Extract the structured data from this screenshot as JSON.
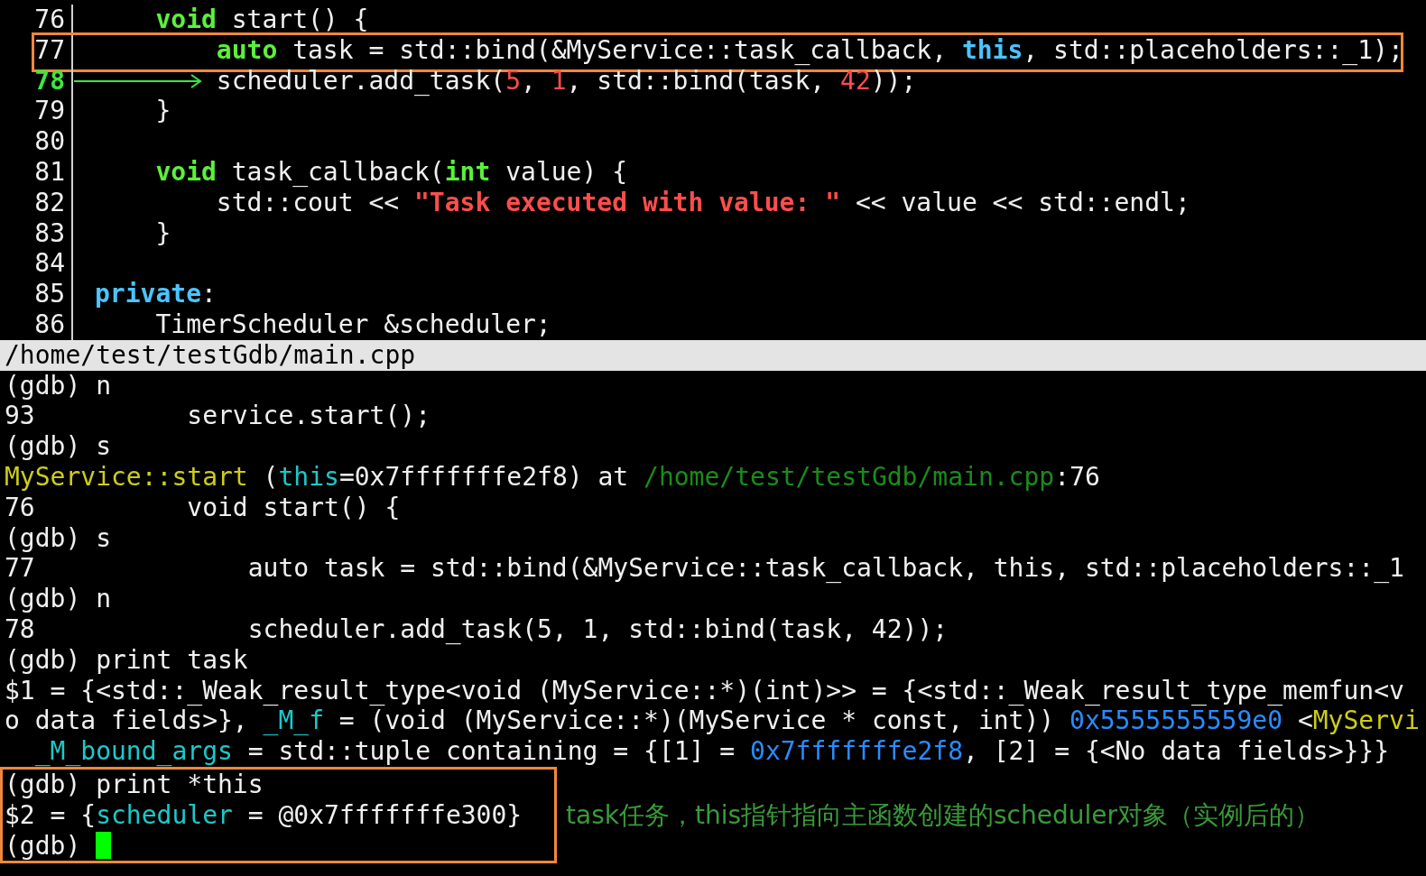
{
  "source": {
    "lines": [
      {
        "number": "76",
        "current": false,
        "boxed": false,
        "segments": [
          {
            "text": "    void",
            "kind": "keyword"
          },
          {
            "text": " start() {",
            "kind": "plain"
          }
        ]
      },
      {
        "number": "77",
        "current": false,
        "boxed": true,
        "segments": [
          {
            "text": "        auto",
            "kind": "keyword"
          },
          {
            "text": " task = std::bind(&MyService::task_callback, ",
            "kind": "plain"
          },
          {
            "text": "this",
            "kind": "this"
          },
          {
            "text": ", std::placeholders::_1);",
            "kind": "plain"
          }
        ]
      },
      {
        "number": "78",
        "current": true,
        "boxed": false,
        "segments": [
          {
            "text": "        scheduler.add_task(",
            "kind": "plain"
          },
          {
            "text": "5",
            "kind": "number"
          },
          {
            "text": ", ",
            "kind": "plain"
          },
          {
            "text": "1",
            "kind": "number"
          },
          {
            "text": ", std::bind(task, ",
            "kind": "plain"
          },
          {
            "text": "42",
            "kind": "number"
          },
          {
            "text": "));",
            "kind": "plain"
          }
        ]
      },
      {
        "number": "79",
        "current": false,
        "boxed": false,
        "segments": [
          {
            "text": "    }",
            "kind": "plain"
          }
        ]
      },
      {
        "number": "80",
        "current": false,
        "boxed": false
      },
      {
        "number": "81",
        "current": false,
        "boxed": false,
        "segments": [
          {
            "text": "    void",
            "kind": "keyword"
          },
          {
            "text": " task_callback(",
            "kind": "plain"
          },
          {
            "text": "int",
            "kind": "keyword"
          },
          {
            "text": " value) {",
            "kind": "plain"
          }
        ]
      },
      {
        "number": "82",
        "current": false,
        "boxed": false,
        "segments": [
          {
            "text": "        std::cout << ",
            "kind": "plain"
          },
          {
            "text": "\"Task executed with value: \"",
            "kind": "string"
          },
          {
            "text": " << value << std::endl;",
            "kind": "plain"
          }
        ]
      },
      {
        "number": "83",
        "current": false,
        "boxed": false,
        "segments": [
          {
            "text": "    }",
            "kind": "plain"
          }
        ]
      },
      {
        "number": "84",
        "current": false,
        "boxed": false
      },
      {
        "number": "85",
        "current": false,
        "boxed": false,
        "segments": [
          {
            "text": "private",
            "kind": "this"
          },
          {
            "text": ":",
            "kind": "plain"
          }
        ]
      },
      {
        "number": "86",
        "current": false,
        "boxed": false,
        "segments": [
          {
            "text": "    TimerScheduler &scheduler;",
            "kind": "plain"
          }
        ]
      }
    ]
  },
  "status_bar": "/home/test/testGdb/main.cpp",
  "console": {
    "lines": [
      {
        "segments": [
          {
            "text": "(gdb) n",
            "kind": "plain"
          }
        ]
      },
      {
        "segments": [
          {
            "text": "93          service.start();",
            "kind": "plain"
          }
        ]
      },
      {
        "segments": [
          {
            "text": "(gdb) s",
            "kind": "plain"
          }
        ]
      },
      {
        "segments": [
          {
            "text": "MyService::start",
            "kind": "function"
          },
          {
            "text": " (",
            "kind": "plain"
          },
          {
            "text": "this",
            "kind": "var"
          },
          {
            "text": "=0x7fffffffe2f8) at ",
            "kind": "plain"
          },
          {
            "text": "/home/test/testGdb/main.cpp",
            "kind": "path"
          },
          {
            "text": ":76",
            "kind": "plain"
          }
        ]
      },
      {
        "segments": [
          {
            "text": "76          void start() {",
            "kind": "plain"
          }
        ]
      },
      {
        "segments": [
          {
            "text": "(gdb) s",
            "kind": "plain"
          }
        ]
      },
      {
        "segments": [
          {
            "text": "77              auto task = std::bind(&MyService::task_callback, this, std::placeholders::_1",
            "kind": "plain"
          }
        ]
      },
      {
        "segments": [
          {
            "text": "(gdb) n",
            "kind": "plain"
          }
        ]
      },
      {
        "segments": [
          {
            "text": "78              scheduler.add_task(5, 1, std::bind(task, 42));",
            "kind": "plain"
          }
        ]
      },
      {
        "segments": [
          {
            "text": "(gdb) print task",
            "kind": "plain"
          }
        ]
      },
      {
        "segments": [
          {
            "text": "$1 = {<std::_Weak_result_type<void (MyService::*)(int)>> = {<std::_Weak_result_type_memfun<v",
            "kind": "plain"
          }
        ]
      },
      {
        "segments": [
          {
            "text": "o data fields>}, ",
            "kind": "plain"
          },
          {
            "text": "_M_f",
            "kind": "var"
          },
          {
            "text": " = (void (MyService::*)(MyService * const, int)) ",
            "kind": "plain"
          },
          {
            "text": "0x5555555559e0",
            "kind": "address"
          },
          {
            "text": " <",
            "kind": "plain"
          },
          {
            "text": "MyServi",
            "kind": "function"
          }
        ]
      },
      {
        "segments": [
          {
            "text": "  _M_bound_args",
            "kind": "var"
          },
          {
            "text": " = std::tuple containing = {[1] = ",
            "kind": "plain"
          },
          {
            "text": "0x7fffffffe2f8",
            "kind": "address"
          },
          {
            "text": ", [2] = {<No data fields>}}}",
            "kind": "plain"
          }
        ]
      }
    ],
    "highlighted_block": {
      "lines": [
        {
          "cursor": false,
          "segments": [
            {
              "text": "(gdb) print *this",
              "kind": "plain"
            }
          ]
        },
        {
          "cursor": false,
          "segments": [
            {
              "text": "$2 = {",
              "kind": "plain"
            },
            {
              "text": "scheduler",
              "kind": "var"
            },
            {
              "text": " = @0x7fffffffe300}",
              "kind": "plain"
            }
          ]
        },
        {
          "cursor": true,
          "segments": [
            {
              "text": "(gdb)",
              "kind": "plain"
            }
          ]
        }
      ],
      "note": "task任务，this指针指向主函数创建的scheduler对象（实例后的）"
    }
  }
}
